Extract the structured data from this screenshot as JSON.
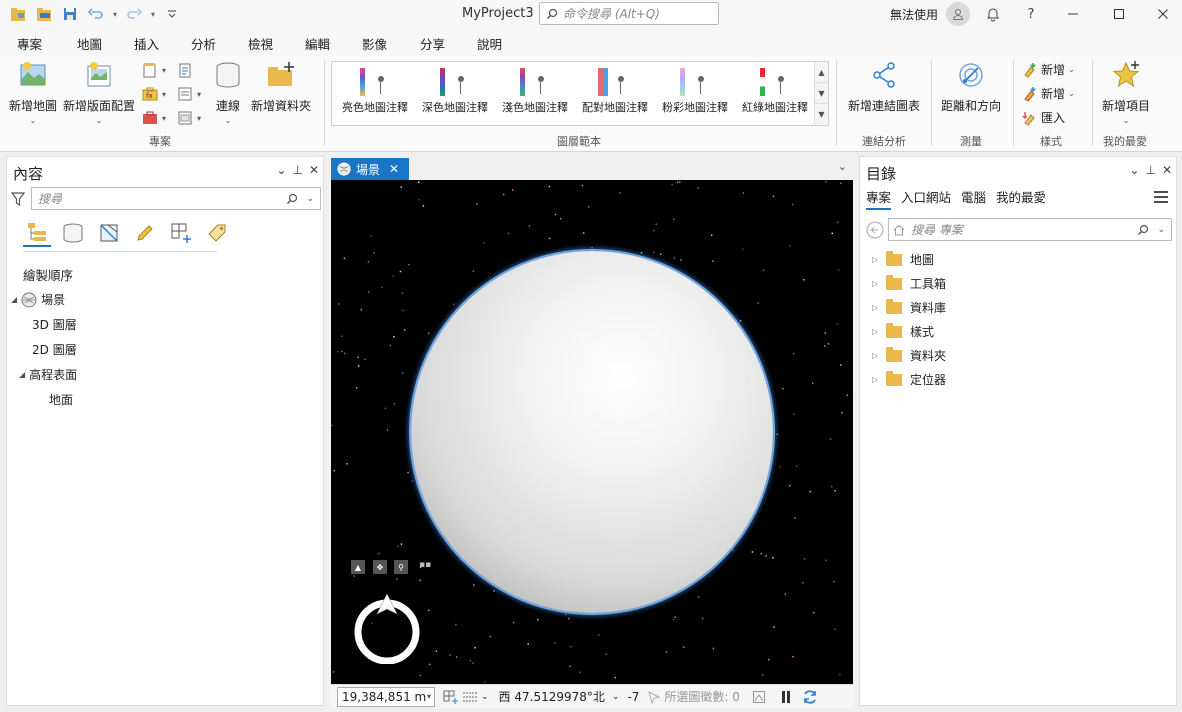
{
  "window": {
    "title": "MyProject3",
    "command_search_placeholder": "命令搜尋 (Alt+Q)",
    "signin_label": "無法使用",
    "help": "?"
  },
  "menu": {
    "tabs": [
      "專案",
      "地圖",
      "插入",
      "分析",
      "檢視",
      "編輯",
      "影像",
      "分享",
      "說明"
    ],
    "active": "插入"
  },
  "ribbon": {
    "new_map": "新增地圖",
    "new_layout": "新增版面配置",
    "connection": "連線",
    "new_folder": "新增資料夾",
    "group_project": "專案",
    "gallery": [
      "亮色地圖注釋",
      "深色地圖注釋",
      "淺色地圖注釋",
      "配對地圖注釋",
      "粉彩地圖注釋",
      "紅綠地圖注釋"
    ],
    "group_layer_templates": "圖層範本",
    "new_link_chart": "新增連結圖表",
    "group_link_analysis": "連結分析",
    "distance_direction": "距離和方向",
    "group_measure": "測量",
    "style_new_1": "新增",
    "style_new_2": "新增",
    "style_import": "匯入",
    "group_styles": "樣式",
    "new_item": "新增項目",
    "group_favorites": "我的最愛"
  },
  "contents_panel": {
    "title": "內容",
    "search_placeholder": "搜尋",
    "drawing_order": "繪製順序",
    "tree": {
      "scene": "場景",
      "layers_3d": "3D 圖層",
      "layers_2d": "2D 圖層",
      "elevation": "高程表面",
      "ground": "地面"
    }
  },
  "scene": {
    "tab_label": "場景"
  },
  "statusbar": {
    "scale": "19,384,851 m",
    "coordinates": "西 47.5129978°北",
    "extra": "-7",
    "selected_features": "所選圖徵數: 0"
  },
  "catalog_panel": {
    "title": "目錄",
    "tabs": [
      "專案",
      "入口網站",
      "電腦",
      "我的最愛"
    ],
    "active_tab": "專案",
    "search_placeholder": "搜尋 專案",
    "items": [
      "地圖",
      "工具箱",
      "資料庫",
      "樣式",
      "資料夾",
      "定位器"
    ]
  },
  "colors": {
    "accent": "#1a75c7",
    "folder": "#e8b84a",
    "scene_bg": "#000000"
  }
}
